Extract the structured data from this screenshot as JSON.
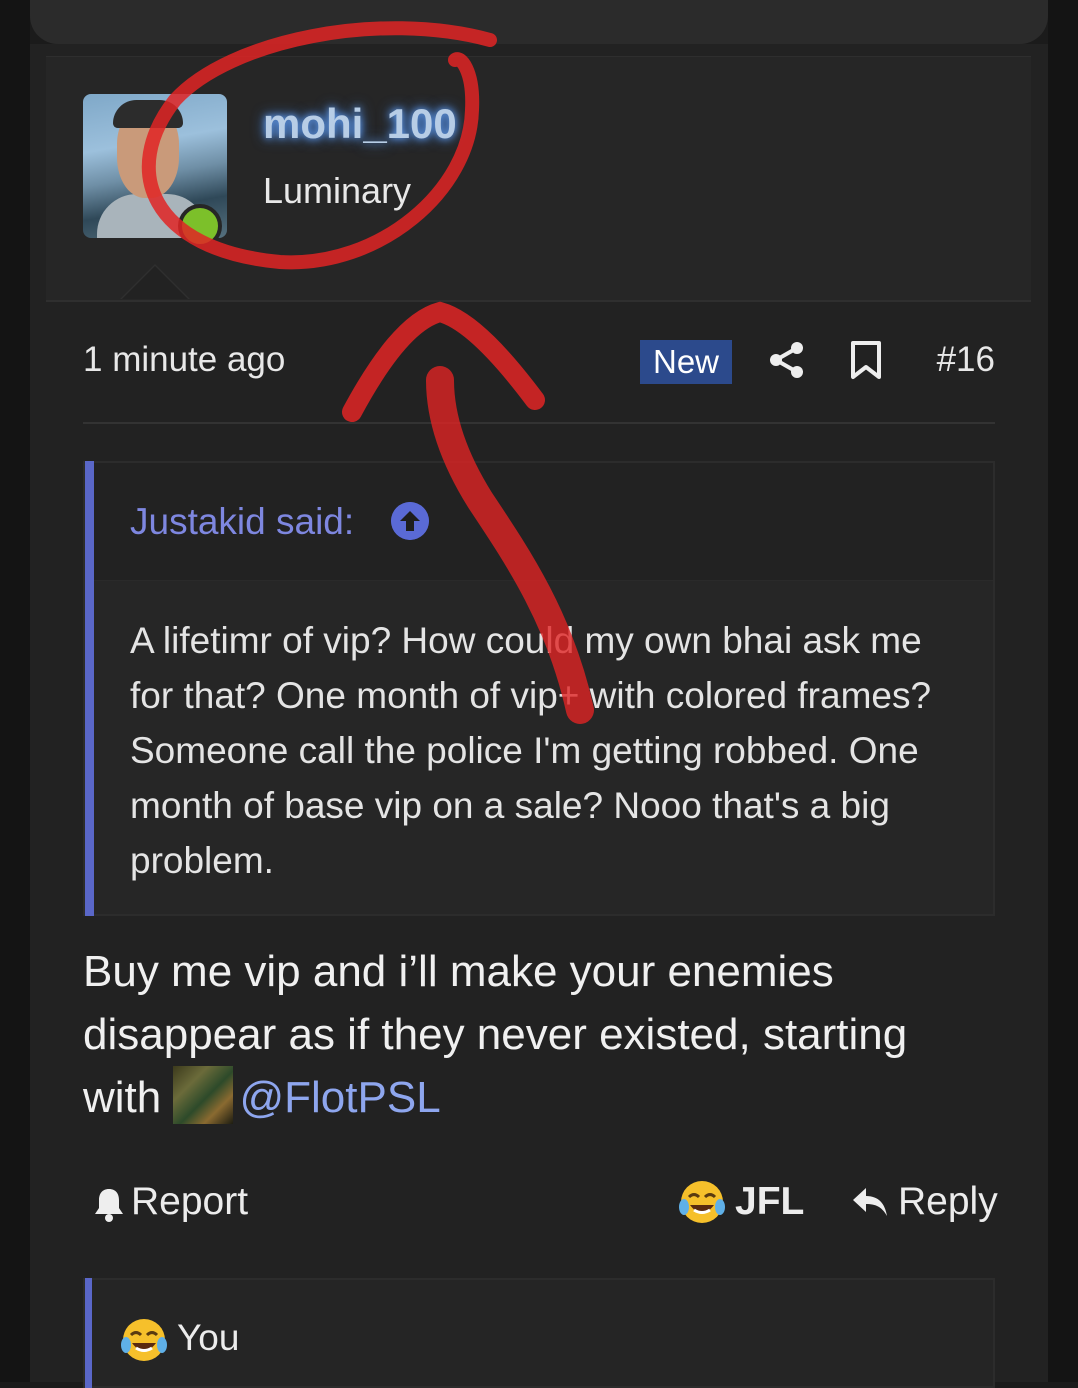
{
  "user": {
    "name": "mohi_100",
    "title": "Luminary"
  },
  "post": {
    "time": "1 minute ago",
    "badge": "New",
    "number": "#16"
  },
  "quote": {
    "author": "Justakid said:",
    "text": "A lifetimr of vip? How could my own bhai ask me for that? One month of vip+ with colored frames? Someone call the police I'm getting robbed. One month of base vip on a sale? Nooo that's a big problem."
  },
  "body": {
    "text": "Buy me vip and i’ll make your enemies disappear as if they never existed, starting with",
    "mention": "@FlotPSL"
  },
  "actions": {
    "report": "Report",
    "reaction": "JFL",
    "reply": "Reply"
  },
  "reactions_summary": {
    "text": "You"
  },
  "colors": {
    "accent": "#5a67c8",
    "link": "#8ea6ee",
    "badge": "#2c4a8c",
    "online": "#7cc02a",
    "annotation": "#e02424"
  },
  "icons": [
    "share-icon",
    "bookmark-icon",
    "arrow-up-icon",
    "bell-icon",
    "laughing-crying-emoji",
    "reply-icon"
  ]
}
